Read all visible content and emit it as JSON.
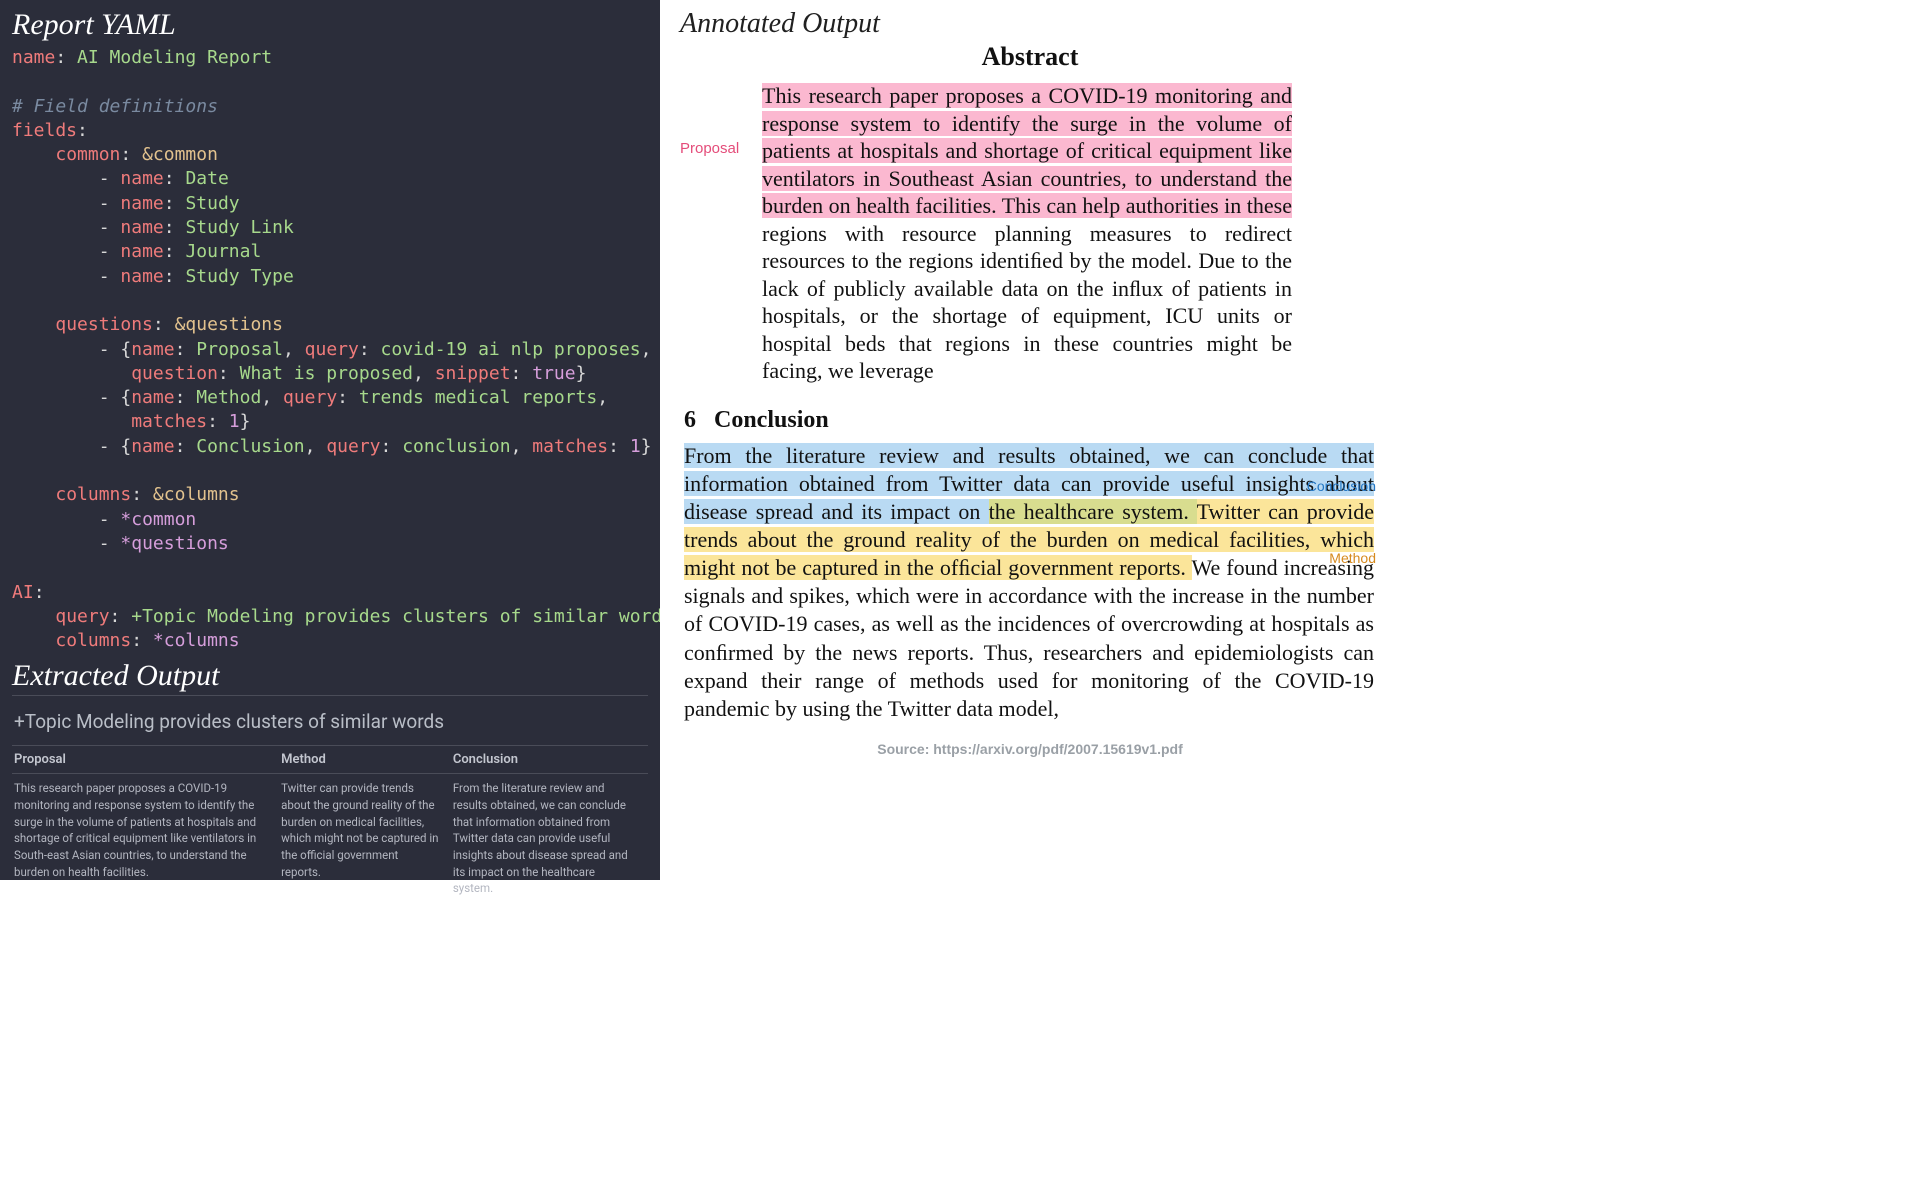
{
  "left": {
    "heading": "Report YAML",
    "yaml": {
      "nameKey": "name",
      "nameVal": "AI Modeling Report",
      "comment": "# Field definitions",
      "fieldsKey": "fields",
      "commonKey": "common",
      "commonAnchor": "&common",
      "commonItems": [
        "Date",
        "Study",
        "Study Link",
        "Journal",
        "Study Type"
      ],
      "itemNameKey": "name",
      "questionsKey": "questions",
      "questionsAnchor": "&questions",
      "q1": {
        "name": "Proposal",
        "query": "covid-19 ai nlp proposes",
        "questionKey": "question",
        "questionVal": "What is proposed",
        "snippetKey": "snippet",
        "snippetVal": "true"
      },
      "q2": {
        "name": "Method",
        "query": "trends medical reports",
        "matchesKey": "matches",
        "matchesVal": "1"
      },
      "q3": {
        "name": "Conclusion",
        "query": "conclusion",
        "matchesKey": "matches",
        "matchesVal": "1"
      },
      "nameK": "name",
      "queryK": "query",
      "columnsKey": "columns",
      "columnsAnchor": "&columns",
      "colRef1": "*common",
      "colRef2": "*questions",
      "aiKey": "AI",
      "aiQueryKey": "query",
      "aiQueryVal": "+Topic Modeling provides clusters of similar words",
      "aiColumnsKey": "columns",
      "aiColumnsVal": "*columns"
    },
    "extracted": {
      "heading": "Extracted Output",
      "title": "+Topic Modeling provides clusters of similar words",
      "cols": {
        "c1": "Proposal",
        "c2": "Method",
        "c3": "Conclusion"
      },
      "row": {
        "c1": "This research paper proposes a COVID-19 monitoring and response system to identify the surge in the volume of patients at hospitals and shortage of critical equipment like ventilators in South-east Asian countries, to understand the burden on health facilities.",
        "c2": "Twitter can provide trends about the ground reality of the burden on medical facilities, which might not be captured in the official government reports.",
        "c3": "From the literature review and results obtained, we can conclude that information obtained from Twitter data can provide useful insights about disease spread and its impact on the healthcare system."
      }
    }
  },
  "right": {
    "heading": "Annotated Output",
    "abstractTitle": "Abstract",
    "labels": {
      "proposal": "Proposal",
      "conclusion": "Conclusion",
      "method": "Method"
    },
    "abstractHL": "This research paper proposes a COVID-19 monitoring and response system to identify the surge in the volume of patients at hospitals and shortage of critical equipment like ventilators in Southeast Asian countries, to understand the burden on health facilities. ",
    "abstractHL2": "This can help authorities in these ",
    "abstractRest": "regions with resource planning measures to redirect resources to the regions identiﬁed by the model. Due to the lack of publicly available data on the inﬂux of patients in hospitals, or the shortage of equipment, ICU units or hospital beds that regions in these countries might be facing, we leverage",
    "secNum": "6",
    "secTitle": "Conclusion",
    "conc": {
      "blue1": "From the literature review and results obtained, we can conclude that information obtained from Twitter data can provide useful insights about disease spread and its impact on ",
      "overlap": "the healthcare system. ",
      "yellow1": "Twitter can provide trends about the ground reality of the burden on medical facilities, which might not be captured in the ofﬁcial government reports. ",
      "rest": "We found increasing signals and spikes, which were in accordance with the increase in the number of COVID-19 cases, as well as the incidences of overcrowding at hospitals as conﬁrmed by the news reports. Thus, researchers and epidemiologists can expand their range of methods used for monitoring of the COVID-19 pandemic by using the Twitter data model,"
    },
    "source": "Source: https://arxiv.org/pdf/2007.15619v1.pdf"
  }
}
